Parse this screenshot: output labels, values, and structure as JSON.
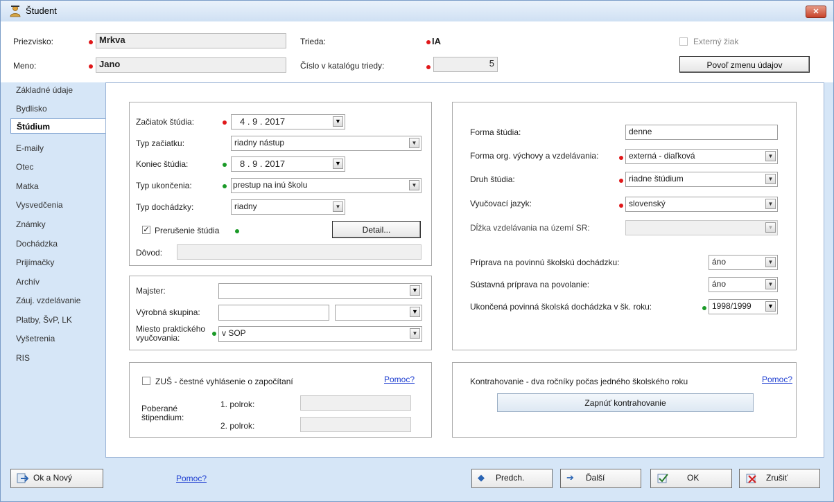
{
  "window": {
    "title": "Študent",
    "close_label": "✕"
  },
  "header": {
    "priezvisko_label": "Priezvisko:",
    "priezvisko_value": "Mrkva",
    "meno_label": "Meno:",
    "meno_value": "Jano",
    "trieda_label": "Trieda:",
    "trieda_value": "IA",
    "cislo_label": "Číslo v katalógu triedy:",
    "cislo_value": "5",
    "externy_label": "Externý žiak",
    "povol_button": "Povoľ zmenu údajov"
  },
  "sidebar": {
    "items": [
      {
        "label": "Základné údaje"
      },
      {
        "label": "Bydlisko"
      },
      {
        "label": "Štúdium"
      },
      {
        "label": "E-maily"
      },
      {
        "label": "Otec"
      },
      {
        "label": "Matka"
      },
      {
        "label": "Vysvedčenia"
      },
      {
        "label": "Známky"
      },
      {
        "label": "Dochádzka"
      },
      {
        "label": "Prijímačky"
      },
      {
        "label": "Archív"
      },
      {
        "label": "Záuj. vzdelávanie"
      },
      {
        "label": "Platby, ŠvP, LK"
      },
      {
        "label": "Vyšetrenia"
      },
      {
        "label": "RIS"
      }
    ]
  },
  "study": {
    "zaciatok_label": "Začiatok štúdia:",
    "zaciatok_value": "4 .  9 . 2017",
    "typ_zaciatku_label": "Typ začiatku:",
    "typ_zaciatku_value": "riadny nástup",
    "koniec_label": "Koniec štúdia:",
    "koniec_value": "8 .  9 . 2017",
    "typ_ukoncenia_label": "Typ ukončenia:",
    "typ_ukoncenia_value": "prestup na inú školu",
    "typ_dochadzky_label": "Typ dochádzky:",
    "typ_dochadzky_value": "riadny",
    "prerusenie_label": "Prerušenie štúdia",
    "detail_button": "Detail...",
    "dovod_label": "Dôvod:",
    "dovod_value": ""
  },
  "practice": {
    "majster_label": "Majster:",
    "majster_value": "",
    "vyrobna_label": "Výrobná skupina:",
    "vyrobna_value": "",
    "miesto_label_1": "Miesto praktického",
    "miesto_label_2": "vyučovania:",
    "miesto_value": "v SOP"
  },
  "zus": {
    "label": "ZUŠ - čestné vyhlásenie o započítaní",
    "help": "Pomoc?",
    "stipendium_label_1": "Poberané",
    "stipendium_label_2": "štipendium:",
    "polrok1_label": "1. polrok:",
    "polrok2_label": "2. polrok:",
    "polrok1_value": "",
    "polrok2_value": ""
  },
  "form": {
    "forma_label": "Forma štúdia:",
    "forma_value": "denne",
    "forma_org_label": "Forma org. výchovy a vzdelávania:",
    "forma_org_value": "externá - diaľková",
    "druh_label": "Druh štúdia:",
    "druh_value": "riadne štúdium",
    "jazyk_label": "Vyučovací jazyk:",
    "jazyk_value": "slovenský",
    "dlzka_label": "Dĺžka vzdelávania na území SR:",
    "dlzka_value": "",
    "priprava_label": "Príprava na povinnú školskú dochádzku:",
    "priprava_value": "áno",
    "sustavna_label": "Sústavná príprava na povolanie:",
    "sustavna_value": "áno",
    "ukoncena_label": "Ukončená povinná školská dochádzka v šk. roku:",
    "ukoncena_value": "1998/1999"
  },
  "kontra": {
    "label": "Kontrahovanie - dva ročníky počas jedného školského roku",
    "help": "Pomoc?",
    "button": "Zapnúť kontrahovanie"
  },
  "footer": {
    "ok_novy": "Ok a Nový",
    "help": "Pomoc?",
    "predch": "Predch.",
    "dalsi": "Ďalší",
    "ok": "OK",
    "zrusit": "Zrušiť"
  },
  "colors": {
    "required_dot": "#e0181a",
    "optional_dot": "#1a9a27",
    "window_bg": "#d6e6f7",
    "link": "#1f3fd1"
  }
}
